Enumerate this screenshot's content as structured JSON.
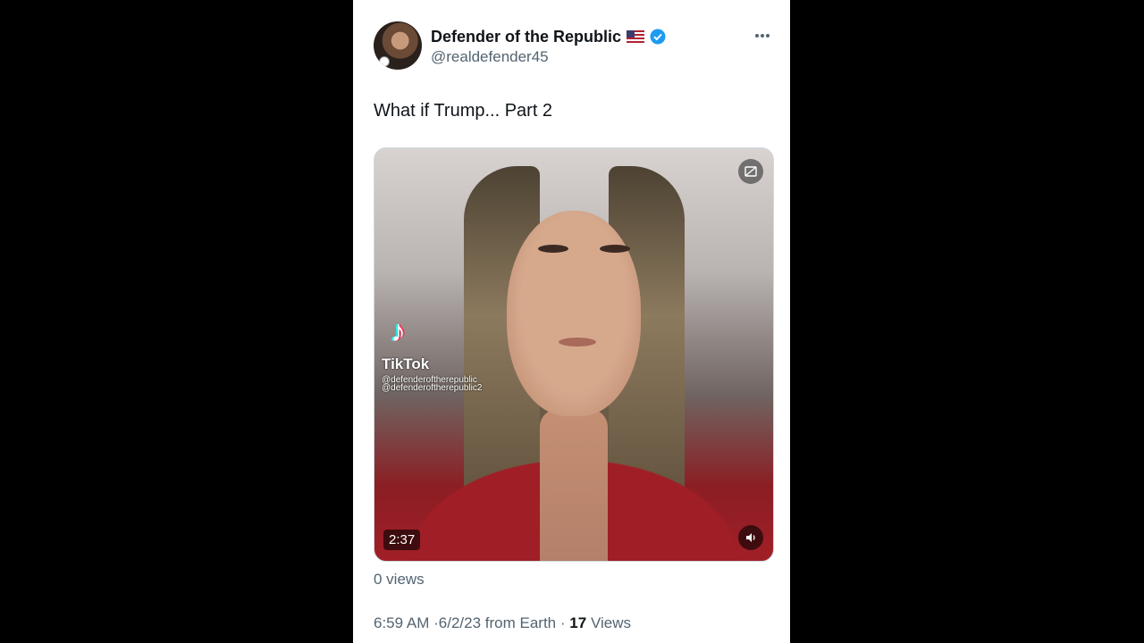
{
  "tweet": {
    "display_name": "Defender of the Republic",
    "handle": "@realdefender45",
    "text": "What if Trump... Part 2",
    "more_icon": "more-horizontal-icon",
    "flag_icon": "us-flag-icon",
    "verified_icon": "verified-badge-icon",
    "verified_color": "#1d9bf0"
  },
  "media": {
    "duration": "2:37",
    "watermark_brand": "TikTok",
    "watermark_handle_1": "@defenderoftherepublic",
    "watermark_handle_2": "@defenderoftherepublic2",
    "corner_icon": "media-settings-icon",
    "volume_icon": "volume-icon"
  },
  "stats": {
    "video_views": "0 views",
    "time": "6:59 AM",
    "separator": "·",
    "date": "6/2/23",
    "source": "from Earth",
    "views_count": "17",
    "views_label": "Views"
  }
}
